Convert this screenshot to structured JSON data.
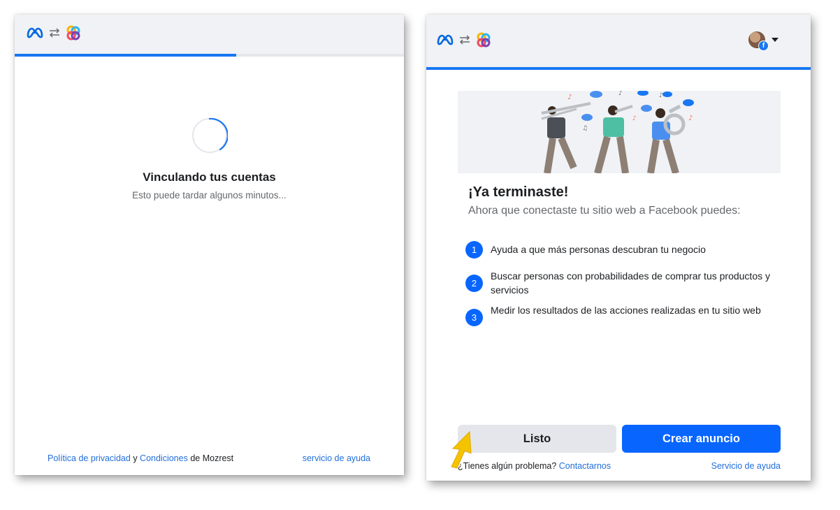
{
  "colors": {
    "accent": "#1877f2",
    "button_primary": "#0866ff",
    "button_secondary": "#e4e6eb",
    "link": "#216fdb",
    "header_bg": "#f0f2f5",
    "cursor": "#f5c400"
  },
  "icons": {
    "meta": "meta-logo-icon",
    "swap": "swap-arrows-icon",
    "partner": "mozrest-logo-icon",
    "avatar": "user-avatar",
    "facebook": "facebook-badge-icon",
    "caret": "caret-down-icon",
    "cursor": "cursor-arrow-icon"
  },
  "left_panel": {
    "progress_percent": 57,
    "loading": {
      "title": "Vinculando tus cuentas",
      "subtitle": "Esto puede tardar algunos minutos..."
    },
    "footer": {
      "privacy_link": "Política de privacidad",
      "and": "y",
      "terms_link": "Condiciones",
      "of_company": "de Mozrest",
      "help_link": "servicio de ayuda"
    }
  },
  "right_panel": {
    "account": {
      "facebook_badge": "f"
    },
    "progress_percent": 100,
    "title": "¡Ya terminaste!",
    "subtitle": "Ahora que conectaste tu sitio web a Facebook puedes:",
    "steps": [
      {
        "num": "1",
        "text": "Ayuda a que más personas descubran tu negocio"
      },
      {
        "num": "2",
        "text": "Buscar personas con probabilidades de comprar tus productos y servicios"
      },
      {
        "num": "3",
        "text": "Medir los resultados de las acciones realizadas en tu sitio web"
      }
    ],
    "buttons": {
      "done": "Listo",
      "create_ad": "Crear anuncio"
    },
    "help": {
      "question": "¿Tienes algún problema?",
      "contact_link": "Contactarnos",
      "help_link": "Servicio de ayuda"
    }
  }
}
